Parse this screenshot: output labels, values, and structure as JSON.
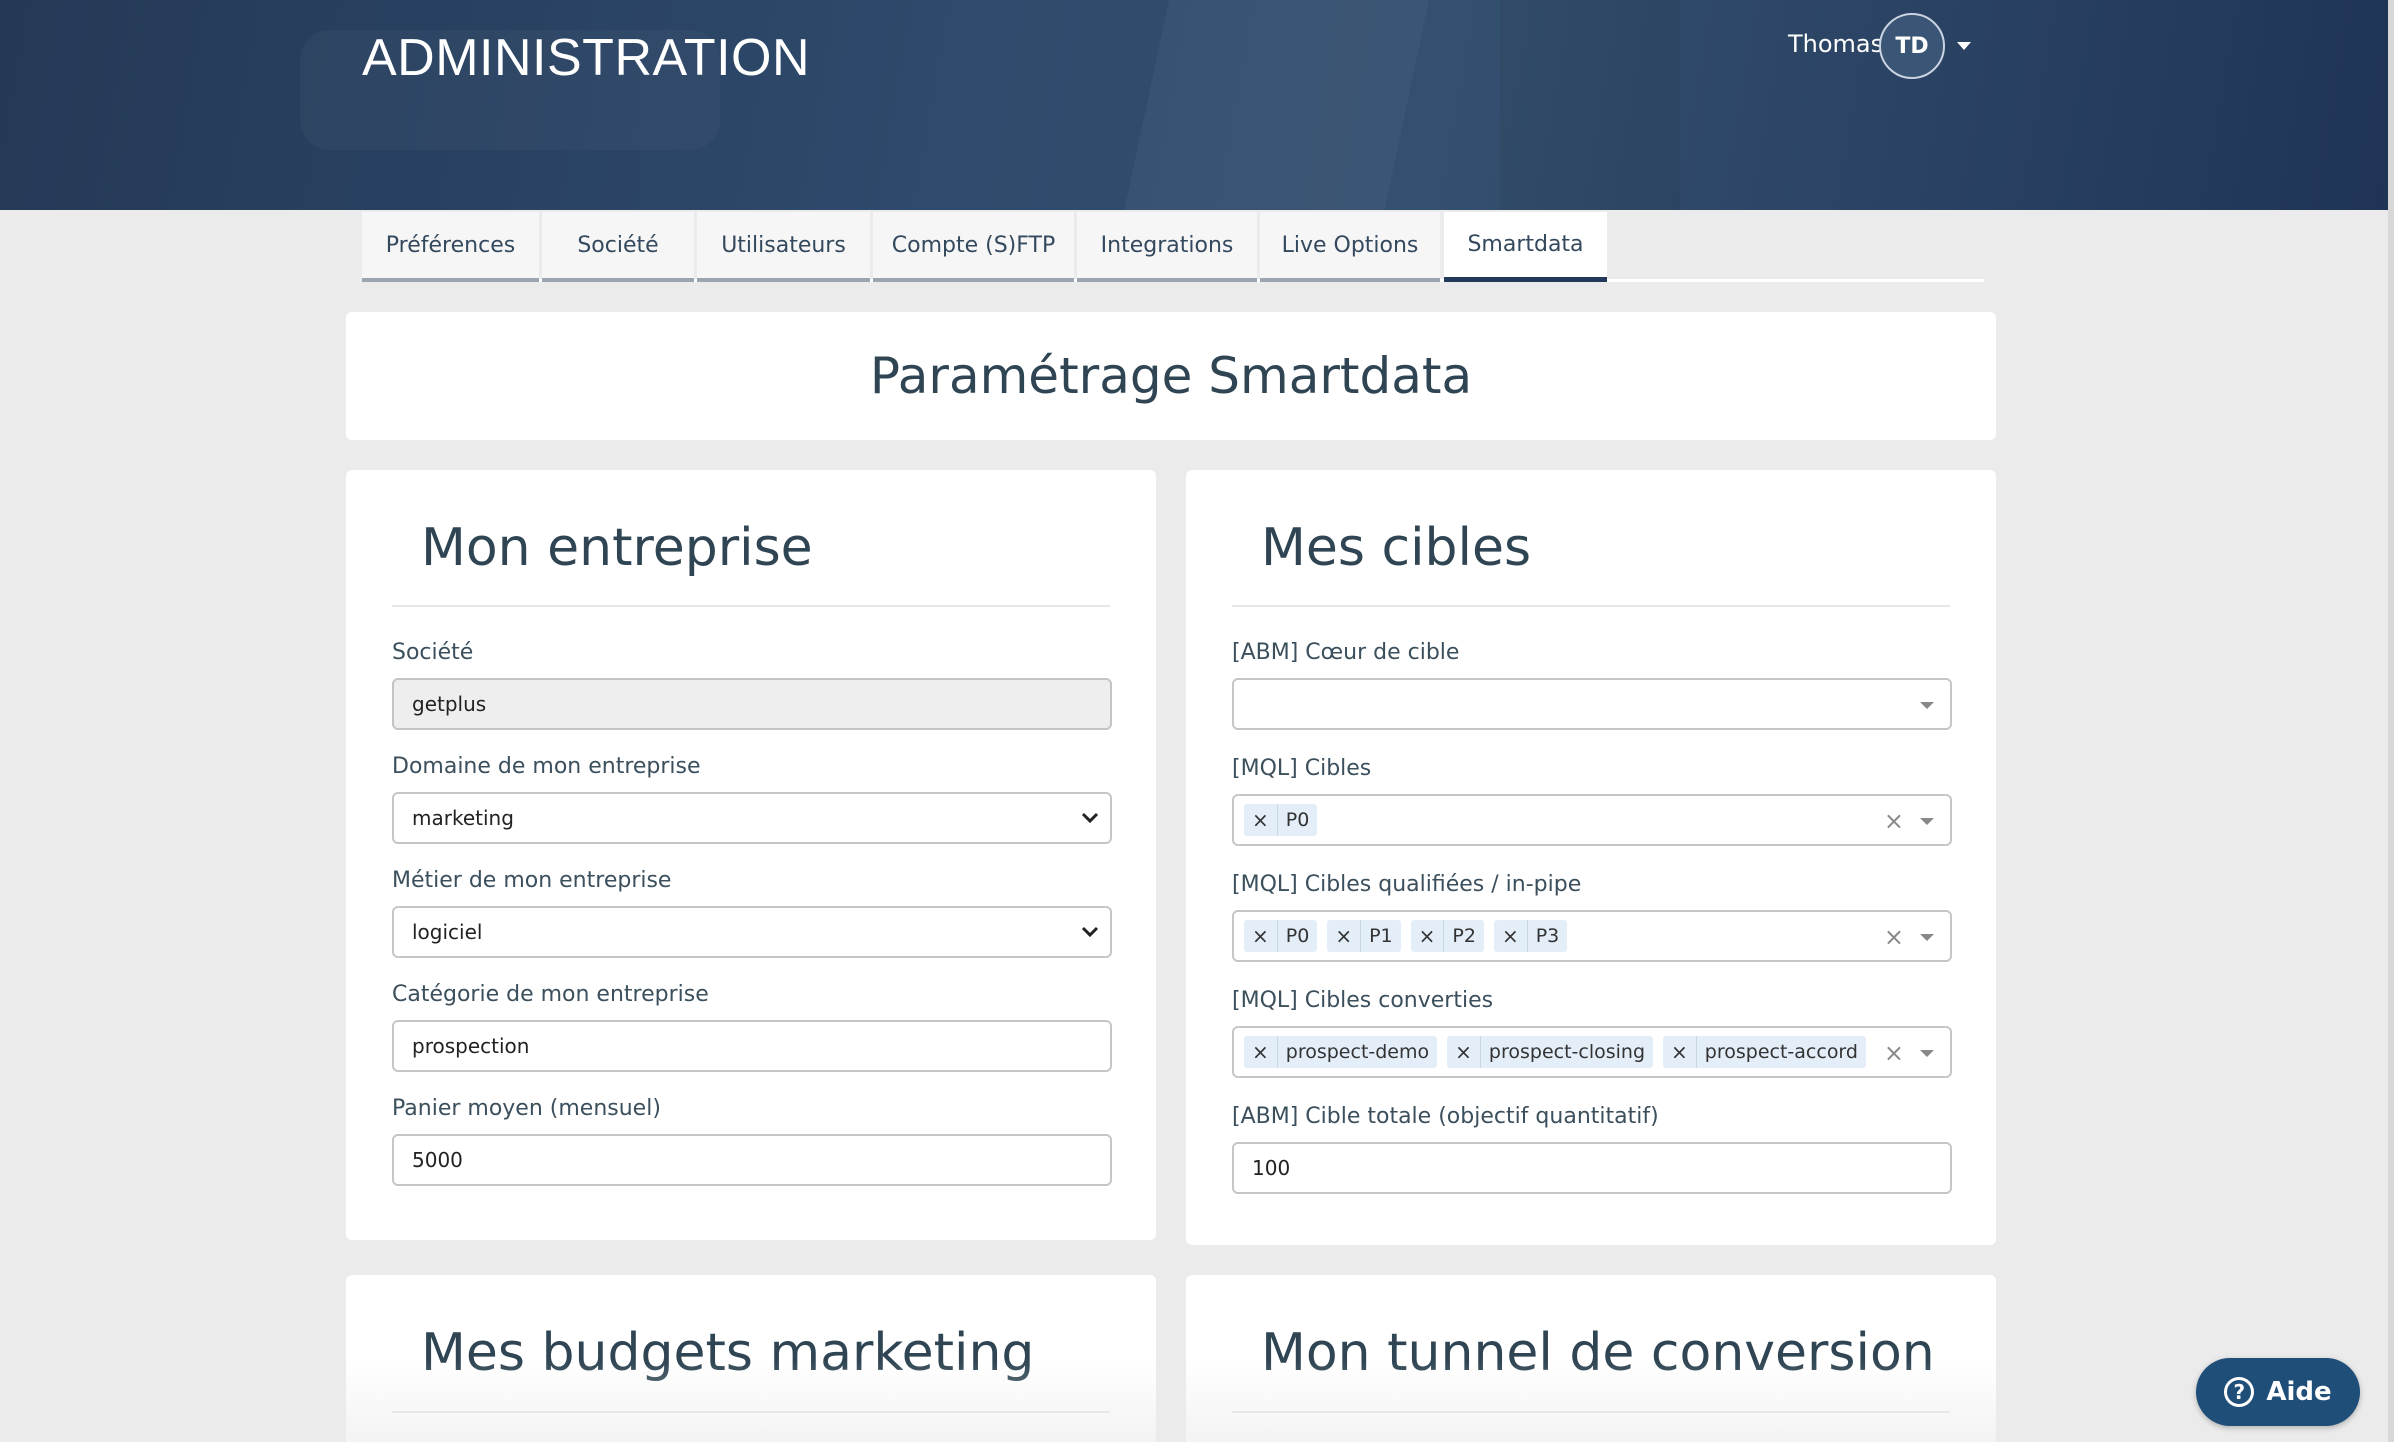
{
  "header": {
    "title": "ADMINISTRATION",
    "user_name": "Thomas",
    "user_initials": "TD"
  },
  "tabs": [
    {
      "label": "Préférences"
    },
    {
      "label": "Société"
    },
    {
      "label": "Utilisateurs"
    },
    {
      "label": "Compte (S)FTP"
    },
    {
      "label": "Integrations"
    },
    {
      "label": "Live Options"
    },
    {
      "label": "Smartdata",
      "active": true
    }
  ],
  "page_title": "Paramétrage Smartdata",
  "mon_entreprise": {
    "title": "Mon entreprise",
    "societe_label": "Société",
    "societe_value": "getplus",
    "domaine_label": "Domaine de mon entreprise",
    "domaine_value": "marketing",
    "metier_label": "Métier de mon entreprise",
    "metier_value": "logiciel",
    "categorie_label": "Catégorie de mon entreprise",
    "categorie_value": "prospection",
    "panier_label": "Panier moyen (mensuel)",
    "panier_value": "5000"
  },
  "mes_cibles": {
    "title": "Mes cibles",
    "coeur_label": "[ABM] Cœur de cible",
    "coeur_value": "",
    "cibles_label": "[MQL] Cibles",
    "cibles_tags": [
      "P0"
    ],
    "qualifiees_label": "[MQL] Cibles qualifiées / in-pipe",
    "qualifiees_tags": [
      "P0",
      "P1",
      "P2",
      "P3"
    ],
    "converties_label": "[MQL] Cibles converties",
    "converties_tags": [
      "prospect-demo",
      "prospect-closing",
      "prospect-accord"
    ],
    "totale_label": "[ABM] Cible totale (objectif quantitatif)",
    "totale_value": "100"
  },
  "budgets": {
    "title": "Mes budgets marketing"
  },
  "tunnel": {
    "title": "Mon tunnel de conversion"
  },
  "help": {
    "label": "Aide",
    "icon": "?"
  },
  "colors": {
    "header": "#2a4263",
    "active_tab": "#23395a",
    "help_button": "#1f4e79",
    "tag_bg": "#e4eef9"
  }
}
